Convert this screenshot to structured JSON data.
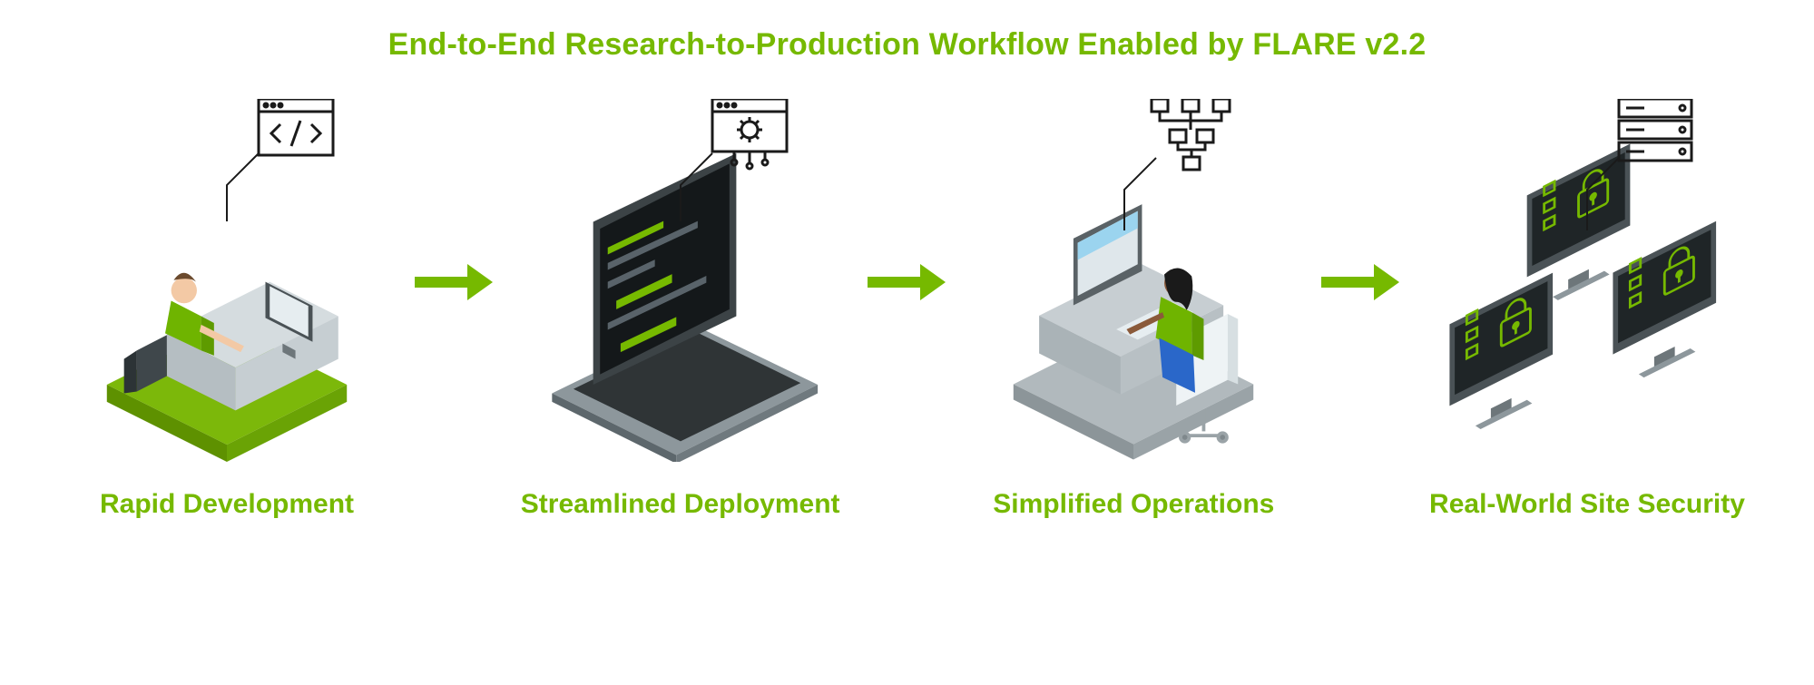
{
  "title": "End-to-End Research-to-Production Workflow Enabled by FLARE v2.2",
  "stages": [
    {
      "label": "Rapid Development",
      "icon": "code-window-icon"
    },
    {
      "label": "Streamlined Deployment",
      "icon": "gear-window-icon"
    },
    {
      "label": "Simplified Operations",
      "icon": "flowchart-icon"
    },
    {
      "label": "Real-World Site Security",
      "icon": "server-rack-icon"
    }
  ],
  "colors": {
    "accent": "#76b900"
  }
}
